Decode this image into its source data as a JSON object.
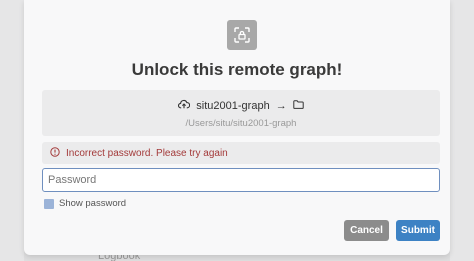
{
  "dialog": {
    "title": "Unlock this remote graph!",
    "graph_name": "situ2001-graph",
    "arrow": "→",
    "graph_path": "/Users/situ/situ2001-graph",
    "error_message": "Incorrect password. Please try again",
    "password_placeholder": "Password",
    "password_value": "",
    "show_password_label": "Show password",
    "cancel_label": "Cancel",
    "submit_label": "Submit"
  },
  "background": {
    "partial_text": "Logbook"
  },
  "colors": {
    "submit": "#3d82c4",
    "cancel": "#8c8c8c",
    "error": "#a33a3a",
    "input_border": "#6f8fbf"
  },
  "icons": {
    "top": "scan-lock-icon",
    "graph": "cloud-upload-icon",
    "folder": "folder-icon",
    "error": "alert-circle-icon"
  }
}
